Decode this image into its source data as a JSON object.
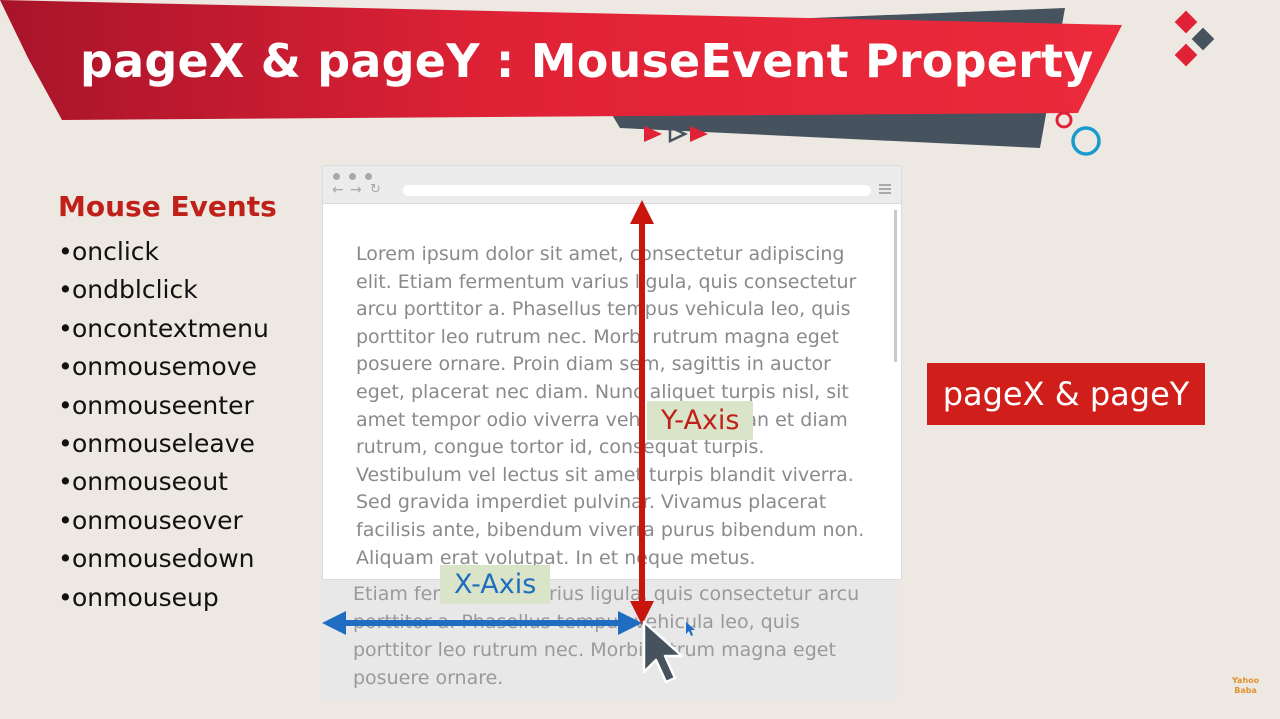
{
  "header": {
    "title": "pageX & pageY : MouseEvent Property"
  },
  "mouse_events": {
    "heading": "Mouse Events",
    "bullet": "•",
    "items": [
      "onclick",
      "ondblclick",
      "oncontextmenu",
      "onmousemove",
      "onmouseenter",
      "onmouseleave",
      "onmouseout",
      "onmouseover",
      "onmousedown",
      "onmouseup"
    ]
  },
  "browser": {
    "paragraph": "Lorem ipsum dolor sit amet, consectetur adipiscing elit. Etiam fermentum varius ligula, quis consectetur arcu porttitor a. Phasellus tempus vehicula leo, quis porttitor leo rutrum nec. Morbi rutrum magna eget posuere ornare. Proin diam sem, sagittis in auctor eget, placerat nec diam. Nunc aliquet turpis nisl, sit amet tempor odio viverra vehicula. Aenean et diam rutrum, congue tortor id, consequat turpis. Vestibulum vel lectus sit amet turpis blandit viverra. Sed gravida imperdiet pulvinar. Vivamus placerat facilisis ante, bibendum viverra purus bibendum non. Aliquam erat volutpat. In et neque metus.",
    "overflow_paragraph": "Etiam fermentum varius ligula, quis consectetur arcu porttitor a. Phasellus tempus vehicula leo, quis porttitor leo rutrum nec. Morbi rutrum magna eget posuere ornare."
  },
  "axes": {
    "x_label": "X-Axis",
    "y_label": "Y-Axis"
  },
  "badge": {
    "label": "pageX & pageY"
  },
  "watermark": {
    "line1": "Yahoo",
    "line2": "Baba"
  },
  "colors": {
    "brand_red": "#d01f1a",
    "dark_red": "#a8142a",
    "slate": "#46525e",
    "x_axis_blue": "#1f6dc0",
    "y_axis_red": "#c0201a",
    "background": "#ede8e1"
  },
  "icons": [
    "play-arrows-icon",
    "diamond-shapes-icon",
    "circles-icon",
    "mouse-cursor-icon"
  ]
}
